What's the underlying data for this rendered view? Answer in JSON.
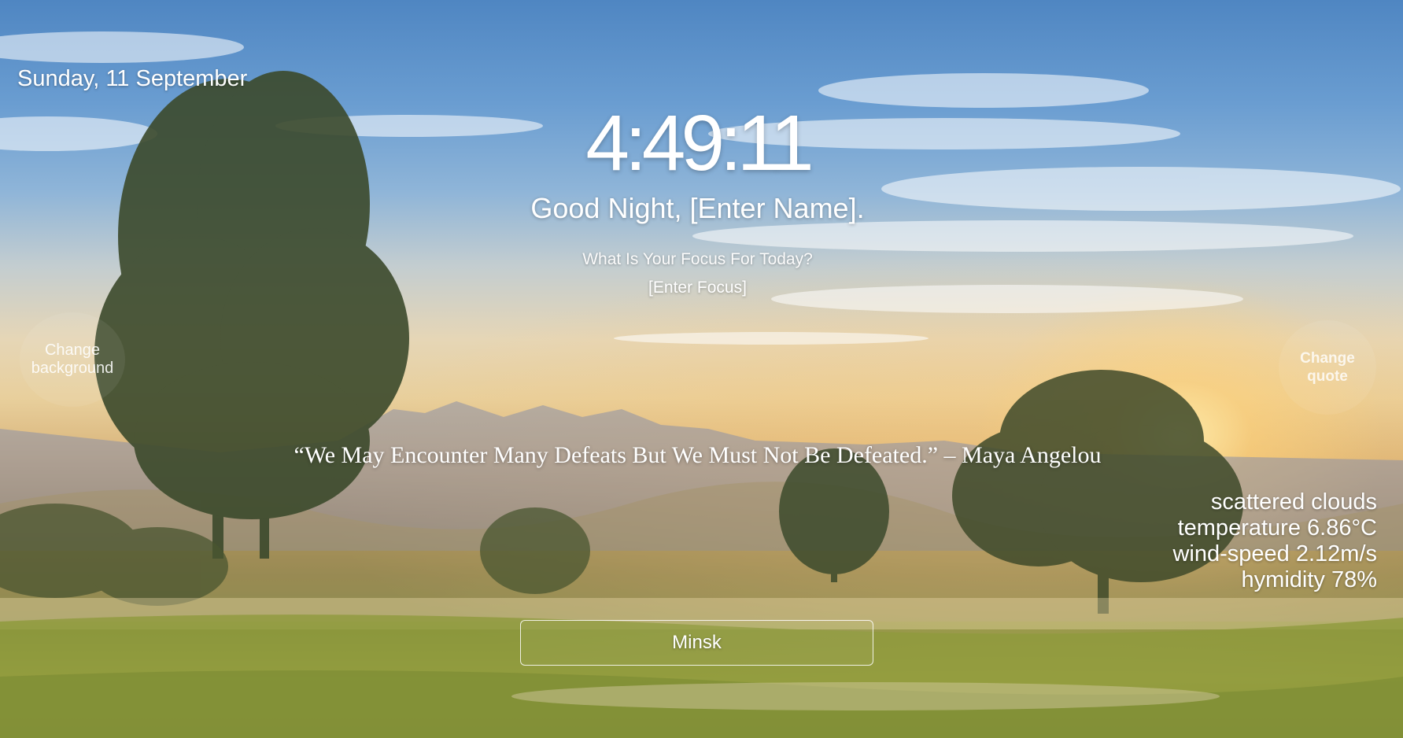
{
  "date": "Sunday, 11 September",
  "clock": "4:49:11",
  "greeting": "Good Night, [Enter Name].",
  "focus": {
    "question": "What Is Your Focus For Today?",
    "value": "[Enter Focus]"
  },
  "buttons": {
    "change_background": "Change background",
    "change_quote": "Change quote"
  },
  "quote": {
    "text": "“We May Encounter Many Defeats But We Must Not Be Defeated.” – Maya Angelou"
  },
  "weather": {
    "description": "scattered clouds",
    "temperature": "temperature 6.86°C",
    "wind": "wind-speed 2.12m/s",
    "humidity": "hymidity 78%"
  },
  "city": {
    "value": "Minsk"
  }
}
